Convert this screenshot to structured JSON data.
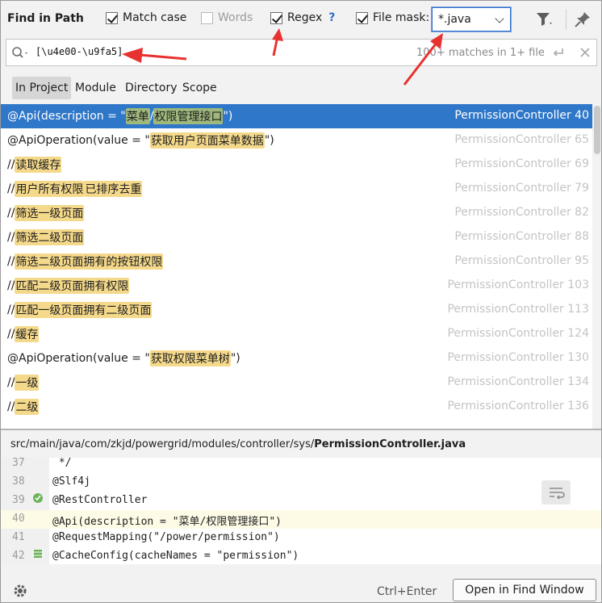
{
  "header": {
    "title": "Find in Path",
    "options": [
      {
        "label": "Match case",
        "checked": true,
        "enabled": true
      },
      {
        "label": "Words",
        "checked": false,
        "enabled": false
      },
      {
        "label": "Regex",
        "checked": true,
        "enabled": true
      },
      {
        "label": "File mask:",
        "checked": true,
        "enabled": true
      }
    ],
    "regex_help": "?",
    "file_mask_value": "*.java"
  },
  "search": {
    "query": "[\\u4e00-\\u9fa5]",
    "match_count": "100+ matches in 1+ file"
  },
  "scopes": [
    {
      "label": "In Project",
      "active": true
    },
    {
      "label": "Module",
      "active": false
    },
    {
      "label": "Directory",
      "active": false
    },
    {
      "label": "Scope",
      "active": false
    }
  ],
  "results": [
    {
      "pre": "@Api(description = \"",
      "hl": "菜单",
      "mid": "/",
      "hl2": "权限管理接口",
      "post": "\")",
      "file": "PermissionController",
      "line": "40",
      "selected": true
    },
    {
      "pre": "@ApiOperation(value = \"",
      "hl": "获取用户页面菜单数据",
      "mid": "",
      "hl2": "",
      "post": "\")",
      "file": "PermissionController",
      "line": "65",
      "selected": false
    },
    {
      "pre": "// ",
      "hl": "读取缓存",
      "mid": "",
      "hl2": "",
      "post": "",
      "file": "PermissionController",
      "line": "69",
      "selected": false
    },
    {
      "pre": "// ",
      "hl": "用户所有权限",
      "mid": " ",
      "hl2": "已排序去重",
      "post": "",
      "file": "PermissionController",
      "line": "79",
      "selected": false
    },
    {
      "pre": "//",
      "hl": "筛选一级页面",
      "mid": "",
      "hl2": "",
      "post": "",
      "file": "PermissionController",
      "line": "82",
      "selected": false
    },
    {
      "pre": "//",
      "hl": "筛选二级页面",
      "mid": "",
      "hl2": "",
      "post": "",
      "file": "PermissionController",
      "line": "88",
      "selected": false
    },
    {
      "pre": "//",
      "hl": "筛选二级页面拥有的按钮权限",
      "mid": "",
      "hl2": "",
      "post": "",
      "file": "PermissionController",
      "line": "95",
      "selected": false
    },
    {
      "pre": "//",
      "hl": "匹配二级页面拥有权限",
      "mid": "",
      "hl2": "",
      "post": "",
      "file": "PermissionController",
      "line": "103",
      "selected": false
    },
    {
      "pre": "//",
      "hl": "匹配一级页面拥有二级页面",
      "mid": "",
      "hl2": "",
      "post": "",
      "file": "PermissionController",
      "line": "113",
      "selected": false
    },
    {
      "pre": "// ",
      "hl": "缓存",
      "mid": "",
      "hl2": "",
      "post": "",
      "file": "PermissionController",
      "line": "124",
      "selected": false
    },
    {
      "pre": "@ApiOperation(value = \"",
      "hl": "获取权限菜单树",
      "mid": "",
      "hl2": "",
      "post": "\")",
      "file": "PermissionController",
      "line": "130",
      "selected": false
    },
    {
      "pre": "//",
      "hl": "一级",
      "mid": "",
      "hl2": "",
      "post": "",
      "file": "PermissionController",
      "line": "134",
      "selected": false
    },
    {
      "pre": "//",
      "hl": "二级",
      "mid": "",
      "hl2": "",
      "post": "",
      "file": "PermissionController",
      "line": "136",
      "selected": false
    }
  ],
  "file_path": {
    "dir": "src/main/java/com/zkjd/powergrid/modules/controller/sys/",
    "file": "PermissionController.java"
  },
  "code_lines": [
    {
      "num": "37",
      "text": " */"
    },
    {
      "num": "38",
      "text": "@Slf4j"
    },
    {
      "num": "39",
      "text": "@RestController"
    },
    {
      "num": "40",
      "text": "@Api(description = \"菜单/权限管理接口\")"
    },
    {
      "num": "41",
      "text": "@RequestMapping(\"/power/permission\")"
    },
    {
      "num": "42",
      "text": "@CacheConfig(cacheNames = \"permission\")"
    }
  ],
  "footer": {
    "shortcut": "Ctrl+Enter",
    "open_button": "Open in Find Window"
  },
  "colors": {
    "selection": "#2f77c8",
    "highlight": "#f5d98b",
    "annotation_arrow": "#e8322f"
  }
}
